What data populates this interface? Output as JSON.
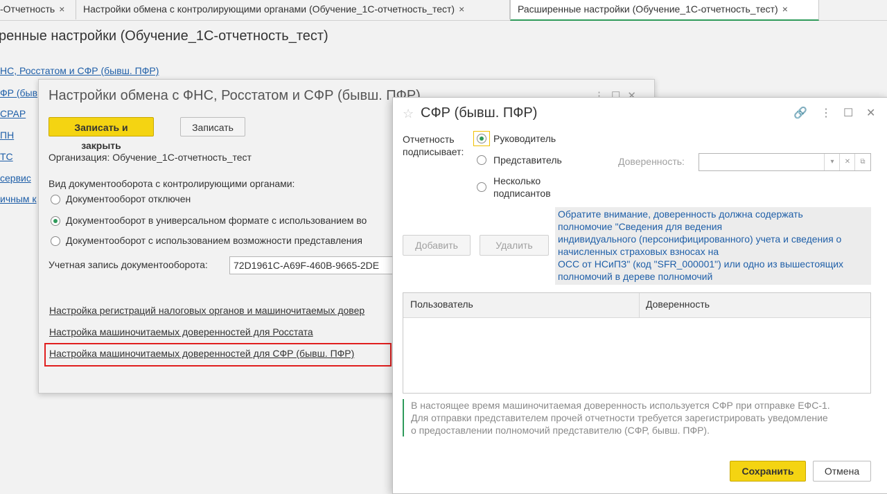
{
  "tabs": [
    {
      "label": "-Отчетность"
    },
    {
      "label": "Настройки обмена с контролирующими органами (Обучение_1С-отчетность_тест)"
    },
    {
      "label": "Расширенные настройки (Обучение_1С-отчетность_тест)"
    }
  ],
  "tab_close": "×",
  "background": {
    "title": "ренные настройки (Обучение_1С-отчетность_тест)",
    "links": [
      "НС, Росстатом и СФР (бывш. ПФР)",
      "ФР (быв",
      "СРАР",
      "ПН",
      "ТС",
      "сервис",
      "ичным к"
    ]
  },
  "exchange_window": {
    "title": "Настройки обмена с ФНС, Росстатом и СФР (бывш. ПФР)",
    "save_close_label": "Записать и закрыть",
    "save_label": "Записать",
    "organization": "Организация: Обучение_1С-отчетность_тест",
    "doc_flow_label": "Вид документооборота с контролирующими органами:",
    "options": [
      {
        "label": "Документооборот отключен",
        "selected": false
      },
      {
        "label": "Документооборот в универсальном формате с использованием во",
        "selected": true
      },
      {
        "label": "Документооборот с использованием возможности представления",
        "selected": false
      }
    ],
    "account_label": "Учетная запись документооборота:",
    "account_value": "72D1961C-A69F-460B-9665-2DE",
    "links": [
      "Настройка регистраций налоговых органов и машиночитаемых довер",
      "Настройка машиночитаемых доверенностей для Росстата",
      "Настройка машиночитаемых доверенностей для СФР (бывш. ПФР)"
    ]
  },
  "sfr_dialog": {
    "title": "СФР (бывш. ПФР)",
    "signer_label_1": "Отчетность",
    "signer_label_2": "подписывает:",
    "signer_options": [
      {
        "label": "Руководитель",
        "selected": true
      },
      {
        "label": "Представитель",
        "selected": false
      },
      {
        "label_1": "Несколько",
        "label_2": "подписантов",
        "selected": false
      }
    ],
    "power_of_attorney_label": "Доверенность:",
    "power_of_attorney_value": "",
    "add_label": "Добавить",
    "delete_label": "Удалить",
    "notice_lines": [
      "Обратите внимание, доверенность должна содержать",
      "полномочие \"Сведения для ведения",
      "индивидуального (персонифицированного) учета и сведения о",
      "начисленных страховых взносах на",
      "ОСС от НСиПЗ\" (код \"SFR_000001\") или одно из вышестоящих",
      "полномочий в дереве полномочий"
    ],
    "table_columns": [
      "Пользователь",
      "Доверенность"
    ],
    "info_lines": [
      "В настоящее время машиночитаемая доверенность используется СФР при отправке ЕФС-1.",
      "Для отправки представителем прочей отчетности требуется зарегистрировать уведомление",
      "о предоставлении полномочий представителю (СФР, бывш. ПФР)."
    ],
    "save_label": "Сохранить",
    "cancel_label": "Отмена"
  },
  "colors": {
    "accent_green": "#2e9a5a",
    "primary_yellow": "#f4d412",
    "link_blue": "#1f5fa8",
    "highlight_red": "#e01e1e"
  }
}
